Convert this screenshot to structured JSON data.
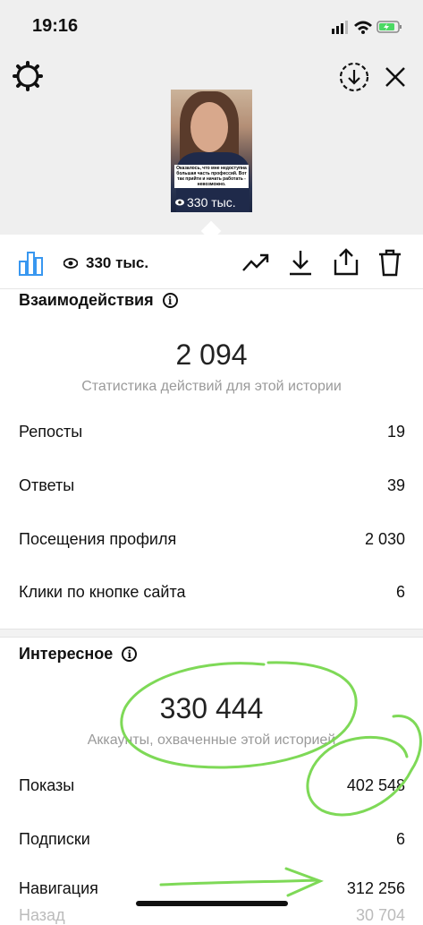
{
  "status_bar": {
    "time": "19:16"
  },
  "story": {
    "caption": "Оказалось, что мне недоступна большая часть профессий. Вот так прийти и начать работать - невозможно.",
    "views_label": "330 тыс."
  },
  "toolbar": {
    "views": "330 тыс."
  },
  "interactions": {
    "title": "Взаимодействия",
    "total": "2 094",
    "caption": "Статистика действий для этой истории",
    "rows": [
      {
        "label": "Репосты",
        "value": "19"
      },
      {
        "label": "Ответы",
        "value": "39"
      },
      {
        "label": "Посещения профиля",
        "value": "2 030"
      },
      {
        "label": "Клики по кнопке сайта",
        "value": "6"
      }
    ]
  },
  "discovery": {
    "title": "Интересное",
    "reach": "330 444",
    "caption": "Аккаунты, охваченные этой историей",
    "rows": [
      {
        "label": "Показы",
        "value": "402 548"
      },
      {
        "label": "Подписки",
        "value": "6"
      },
      {
        "label": "Навигация",
        "value": "312 256"
      },
      {
        "label": "Назад",
        "value": "30 704"
      }
    ]
  },
  "colors": {
    "accent": "#3897f0",
    "annotation": "#7ed957"
  }
}
